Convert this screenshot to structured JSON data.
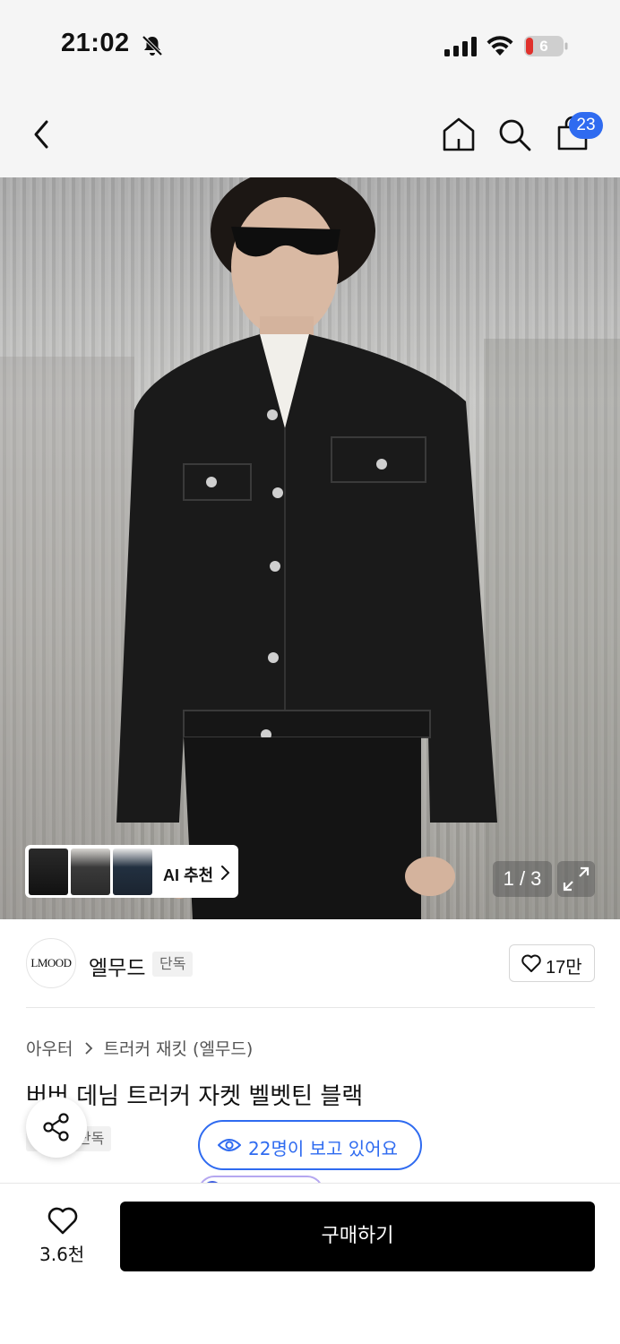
{
  "status": {
    "time": "21:02",
    "battery": "6"
  },
  "nav": {
    "cart_count": "23"
  },
  "image": {
    "page_indicator": "1 / 3",
    "ai_recommend_label": "AI 추천"
  },
  "brand": {
    "logo_text": "LMOOD",
    "name": "엘무드",
    "tag": "단독",
    "like_count": "17만"
  },
  "product": {
    "breadcrumb": [
      "아우터",
      "트러커 재킷 (엘무드)"
    ],
    "title": "버버 데님 트러커 자켓 벨벳틴 블랙",
    "tag": "단독",
    "viewers": "22명이 보고 있어요"
  },
  "bottom": {
    "wish_count": "3.6천",
    "buy_label": "구매하기"
  },
  "colors": {
    "accent": "#2f6bf0",
    "buy_button": "#000000",
    "background": "#ffffff",
    "bar_background": "#f5f5f5"
  },
  "icons": [
    "bell-off-icon",
    "signal-icon",
    "wifi-icon",
    "battery-icon",
    "back-icon",
    "home-icon",
    "search-icon",
    "shopping-bag-icon",
    "expand-icon",
    "heart-icon",
    "share-icon",
    "eye-icon",
    "chevron-right-icon"
  ]
}
